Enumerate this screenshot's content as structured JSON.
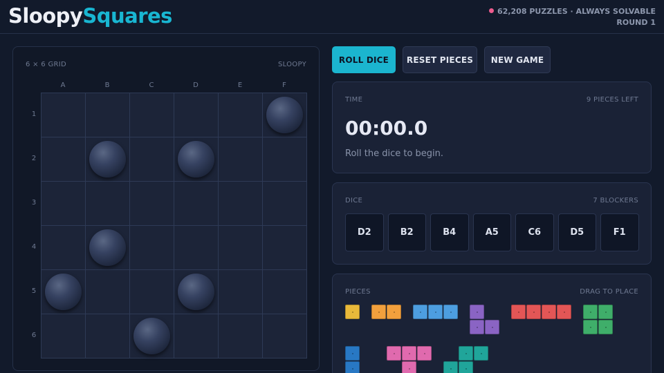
{
  "header": {
    "logo_part1": "Sloopy",
    "logo_part2": "Squares",
    "puzzles": "62,208 PUZZLES · ALWAYS SOLVABLE",
    "round": "ROUND 1"
  },
  "board": {
    "size_label": "6 × 6 GRID",
    "mode_label": "SLOOPY",
    "columns": [
      "A",
      "B",
      "C",
      "D",
      "E",
      "F"
    ],
    "rows": [
      "1",
      "2",
      "3",
      "4",
      "5",
      "6"
    ],
    "blockers": [
      "F1",
      "B2",
      "D2",
      "B4",
      "A5",
      "D5",
      "C6"
    ]
  },
  "toolbar": {
    "roll_label": "ROLL DICE",
    "reset_label": "RESET PIECES",
    "new_label": "NEW GAME"
  },
  "time": {
    "label": "TIME",
    "pieces_left": "9 PIECES LEFT",
    "value": "00:00.0",
    "message": "Roll the dice to begin."
  },
  "dice": {
    "label": "DICE",
    "blockers_count": "7 BLOCKERS",
    "values": [
      "D2",
      "B2",
      "B4",
      "A5",
      "C6",
      "D5",
      "F1"
    ]
  },
  "pieces": {
    "label": "PIECES",
    "hint": "DRAG TO PLACE",
    "colors": {
      "yellow": "#e9b93a",
      "orange": "#f2a03d",
      "blue": "#4d9ee0",
      "purple": "#8a64c4",
      "red": "#e35656",
      "green": "#3fae6a",
      "navy": "#2878c4",
      "pink": "#e06aae",
      "teal": "#20a59a"
    },
    "accent": "#1bb5cf"
  }
}
